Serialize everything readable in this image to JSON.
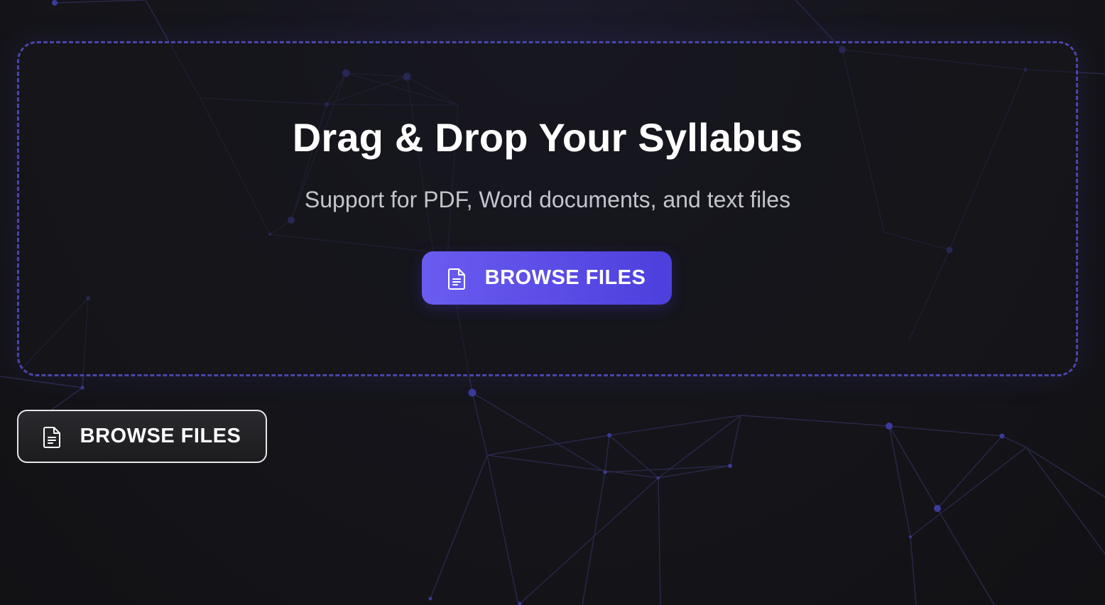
{
  "dropzone": {
    "title": "Drag & Drop Your Syllabus",
    "subtitle": "Support for PDF, Word documents, and text files",
    "browse_button": {
      "label": "BROWSE FILES",
      "icon": "document-icon"
    }
  },
  "secondary_browse_button": {
    "label": "BROWSE FILES",
    "icon": "document-icon"
  },
  "colors": {
    "background": "#141418",
    "accent": "#5b4de8",
    "dropzone_border": "#4a45a8",
    "network_lines": "#2e2d55",
    "network_nodes": "#3f3fa0"
  }
}
